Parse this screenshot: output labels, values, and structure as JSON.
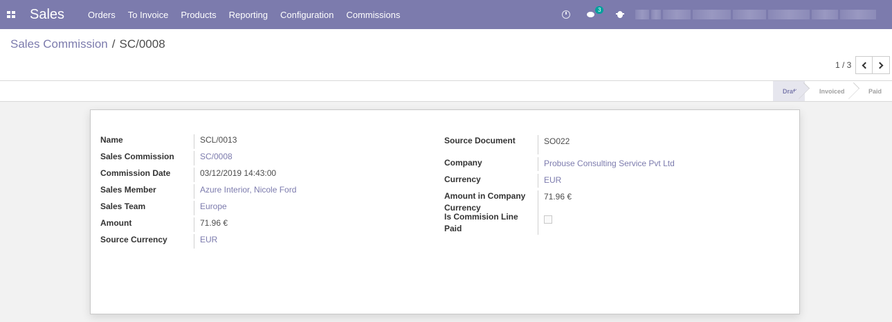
{
  "app": {
    "title": "Sales"
  },
  "menu": [
    "Orders",
    "To Invoice",
    "Products",
    "Reporting",
    "Configuration",
    "Commissions"
  ],
  "systray": {
    "messages_count": "3"
  },
  "breadcrumb": {
    "parent": "Sales Commission",
    "separator": "/",
    "current": "SC/0008"
  },
  "pager": {
    "value": "1 / 3"
  },
  "status": {
    "stages": [
      "Draft",
      "Invoiced",
      "Paid"
    ],
    "active": "Draft"
  },
  "form": {
    "left": [
      {
        "label": "Name",
        "value": "SCL/0013",
        "link": false
      },
      {
        "label": "Sales Commission",
        "value": "SC/0008",
        "link": true
      },
      {
        "label": "Commission Date",
        "value": "03/12/2019 14:43:00",
        "link": false
      },
      {
        "label": "Sales Member",
        "value": "Azure Interior, Nicole Ford",
        "link": true
      },
      {
        "label": "Sales Team",
        "value": "Europe",
        "link": true
      },
      {
        "label": "Amount",
        "value": "71.96 €",
        "link": false
      },
      {
        "label": "Source Currency",
        "value": "EUR",
        "link": true
      }
    ],
    "right": {
      "source_document": {
        "label": "Source Document",
        "value": "SO022"
      },
      "company": {
        "label": "Company",
        "value": "Probuse Consulting Service Pvt Ltd"
      },
      "currency": {
        "label": "Currency",
        "value": "EUR"
      },
      "amount_company_currency": {
        "label_line1": "Amount in Company",
        "label_line2": "Currency",
        "value": "71.96 €"
      },
      "is_paid": {
        "label_line1": "Is Commision Line",
        "label_line2": "Paid",
        "checked": false
      }
    }
  },
  "colors": {
    "navbar": "#7c7bad",
    "link": "#7c7bad",
    "badge": "#00a09d"
  }
}
